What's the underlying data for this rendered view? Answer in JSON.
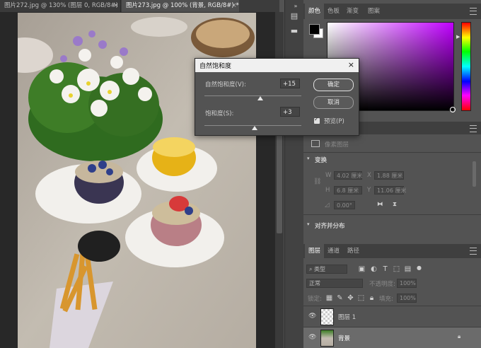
{
  "tabs": [
    {
      "label": "图片272.jpg @ 130% (图层 0, RGB/8#) *",
      "close": "×"
    },
    {
      "label": "图片273.jpg @ 100% (背景, RGB/8#) *",
      "close": "×"
    }
  ],
  "color_panel": {
    "tabs": [
      "颜色",
      "色板",
      "渐变",
      "图案"
    ],
    "active_tab": "颜色",
    "foreground": "#000000",
    "background": "#ffffff",
    "field_hue": "#c000ff"
  },
  "properties_panel": {
    "pixel_layer_label": "像素图层",
    "transform_title": "变换",
    "w_label": "W",
    "w_value": "4.02 厘米",
    "h_label": "H",
    "h_value": "6.8 厘米",
    "x_label": "X",
    "x_value": "1.88 厘米",
    "y_label": "Y",
    "y_value": "11.06 厘米",
    "angle_value": "0.00°",
    "align_title": "对齐并分布"
  },
  "layers_panel": {
    "tabs": [
      "图层",
      "通道",
      "路径"
    ],
    "active_tab": "图层",
    "filter_label": "类型",
    "blend_mode": "正常",
    "opacity_label": "不透明度:",
    "opacity_value": "100%",
    "lock_label": "锁定:",
    "fill_label": "填充:",
    "fill_value": "100%",
    "layers": [
      {
        "name": "图层 1",
        "visible": true,
        "locked": false
      },
      {
        "name": "背景",
        "visible": true,
        "locked": true
      }
    ]
  },
  "dialog": {
    "title": "自然饱和度",
    "close": "×",
    "vibrance_label": "自然饱和度(V):",
    "vibrance_value": "+15",
    "vibrance_range": [
      -100,
      100
    ],
    "saturation_label": "饱和度(S):",
    "saturation_value": "+3",
    "saturation_range": [
      -100,
      100
    ],
    "ok_label": "确定",
    "cancel_label": "取消",
    "preview_label": "预览(P)",
    "preview_checked": true
  }
}
